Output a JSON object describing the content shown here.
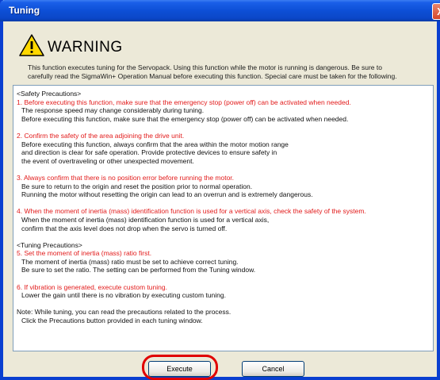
{
  "window": {
    "title": "Tuning",
    "close_glyph": "X"
  },
  "warning": {
    "icon": "warning-triangle-icon",
    "title": "WARNING"
  },
  "intro": {
    "line1": "This function executes tuning for the Servopack. Using this function while the motor is running is dangerous. Be sure to",
    "line2": "carefully read the SigmaWin+ Operation Manual before executing this function. Special care must be taken for the following."
  },
  "precautions": {
    "safety_header": "<Safety Precautions>",
    "s1_title": "1. Before executing this function, make sure that the emergency stop (power off) can be activated when needed.",
    "s1_l1": "The response speed may change considerably during tuning.",
    "s1_l2": "Before executing this function, make sure that the emergency stop (power off) can be activated when needed.",
    "s2_title": "2. Confirm the safety of the area adjoining the drive unit.",
    "s2_l1": "Before executing this function, always confirm that the area within the motor motion range",
    "s2_l2": "and direction is clear for safe operation. Provide protective devices to ensure safety in",
    "s2_l3": "the event of overtraveling or other unexpected movement.",
    "s3_title": "3. Always confirm that there is no position error before running the motor.",
    "s3_l1": "Be sure to return to the origin and reset the position prior to normal operation.",
    "s3_l2": "Running the motor without resetting the origin can lead to an overrun and is extremely dangerous.",
    "s4_title": "4. When the moment of inertia (mass) identification function is used for a vertical axis, check the safety of the system.",
    "s4_l1": "When the moment of inertia (mass) identification function is used for a vertical axis,",
    "s4_l2": "confirm that the axis level does not drop when the servo is turned off.",
    "tuning_header": "<Tuning Precautions>",
    "s5_title": "5. Set the moment of inertia (mass) ratio first.",
    "s5_l1": "The moment of inertia (mass) ratio must be set to achieve correct tuning.",
    "s5_l2": "Be sure to set the ratio. The setting can be performed from the Tuning window.",
    "s6_title": "6. If vibration is generated, execute custom tuning.",
    "s6_l1": "Lower the gain until there is no vibration by executing custom tuning.",
    "note_l1": "Note: While tuning, you can read the precautions related to the process.",
    "note_l2": "Click the Precautions button provided in each tuning window."
  },
  "buttons": {
    "execute": "Execute",
    "cancel": "Cancel"
  },
  "colors": {
    "title_bar": "#0b47c8",
    "highlight": "#e00000",
    "heading_red": "#e21a1a"
  }
}
